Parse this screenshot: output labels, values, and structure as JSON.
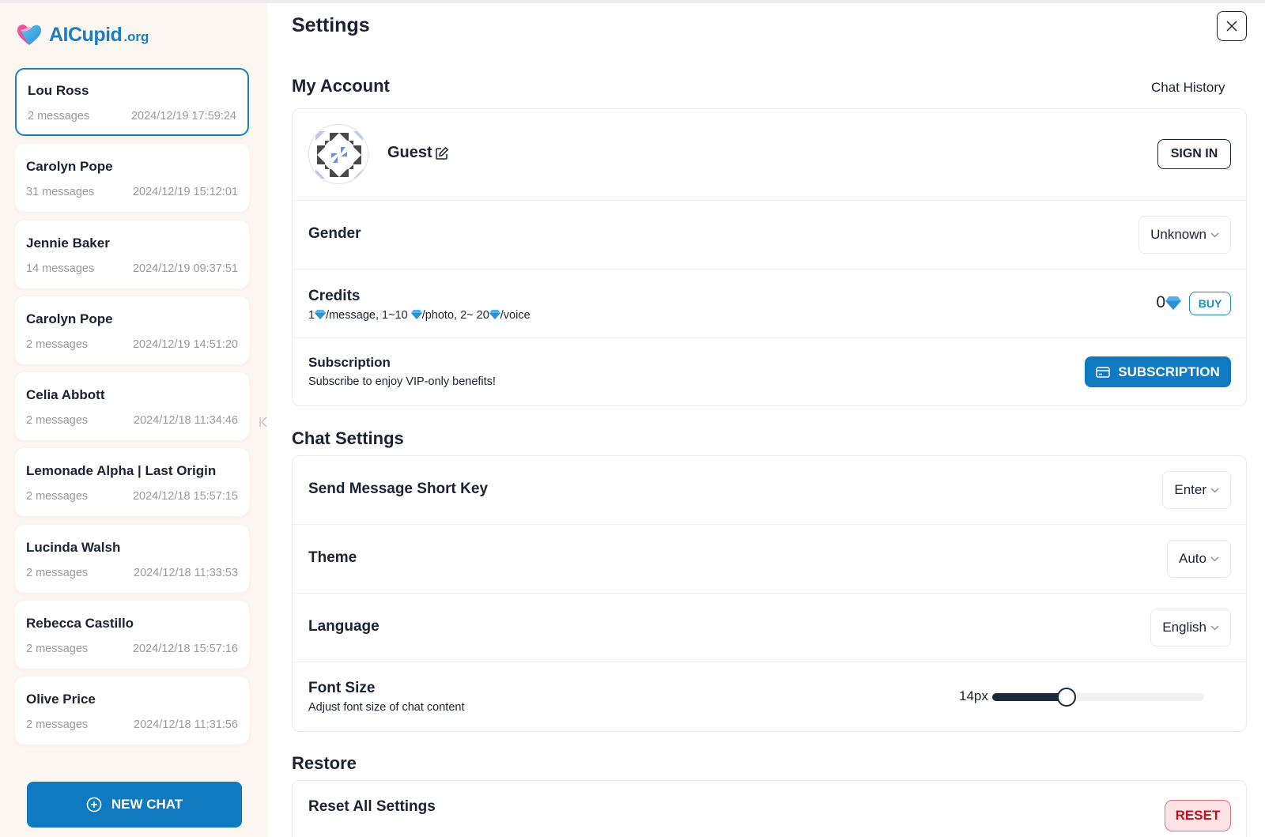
{
  "brand": {
    "name": "AICupid",
    "suffix": ".org",
    "accent": "#0f7ac0"
  },
  "sidebar": {
    "chats": [
      {
        "name": "Lou Ross",
        "count": "2 messages",
        "time": "2024/12/19 17:59:24",
        "active": true
      },
      {
        "name": "Carolyn Pope",
        "count": "31 messages",
        "time": "2024/12/19 15:12:01"
      },
      {
        "name": "Jennie Baker",
        "count": "14 messages",
        "time": "2024/12/19 09:37:51"
      },
      {
        "name": "Carolyn Pope",
        "count": "2 messages",
        "time": "2024/12/19 14:51:20"
      },
      {
        "name": "Celia Abbott",
        "count": "2 messages",
        "time": "2024/12/18 11:34:46"
      },
      {
        "name": "Lemonade Alpha | Last Origin",
        "count": "2 messages",
        "time": "2024/12/18 15:57:15"
      },
      {
        "name": "Lucinda Walsh",
        "count": "2 messages",
        "time": "2024/12/18 11:33:53"
      },
      {
        "name": "Rebecca Castillo",
        "count": "2 messages",
        "time": "2024/12/18 15:57:16"
      },
      {
        "name": "Olive Price",
        "count": "2 messages",
        "time": "2024/12/18 11:31:56"
      }
    ],
    "new_chat_label": "NEW CHAT",
    "collapse_icon": "collapse-left-icon"
  },
  "settings": {
    "title": "Settings",
    "close_icon": "close-icon",
    "my_account": {
      "title": "My Account",
      "chat_history_label": "Chat History",
      "user_name": "Guest",
      "sign_in_label": "SIGN IN",
      "gender_label": "Gender",
      "gender_value": "Unknown",
      "credits_label": "Credits",
      "credits_desc": {
        "p1": "1",
        "p2": "/message, 1~10 ",
        "p3": "/photo, 2~ 20",
        "p4": "/voice"
      },
      "credits_value": "0",
      "buy_label": "BUY",
      "subscription_label": "Subscription",
      "subscription_desc": "Subscribe to enjoy VIP-only benefits!",
      "subscription_button": "SUBSCRIPTION"
    },
    "chat_settings": {
      "title": "Chat Settings",
      "send_key_label": "Send Message Short Key",
      "send_key_value": "Enter",
      "theme_label": "Theme",
      "theme_value": "Auto",
      "language_label": "Language",
      "language_value": "English",
      "font_size_label": "Font Size",
      "font_size_desc": "Adjust font size of chat content",
      "font_size_value": "14px",
      "font_size_fraction": 0.35
    },
    "restore": {
      "title": "Restore",
      "reset_label": "Reset All Settings",
      "reset_button": "RESET"
    }
  }
}
